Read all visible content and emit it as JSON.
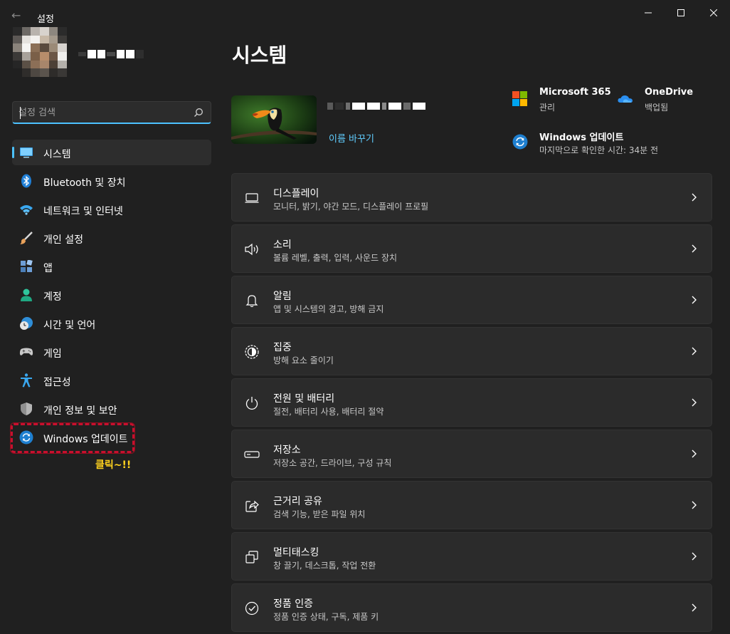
{
  "window": {
    "title": "설정",
    "back_glyph": "←"
  },
  "search": {
    "placeholder": "설정 검색"
  },
  "sidebar": {
    "items": [
      {
        "label": "시스템",
        "icon": "system-icon",
        "selected": true
      },
      {
        "label": "Bluetooth 및 장치",
        "icon": "bluetooth-icon"
      },
      {
        "label": "네트워크 및 인터넷",
        "icon": "wifi-icon"
      },
      {
        "label": "개인 설정",
        "icon": "brush-icon"
      },
      {
        "label": "앱",
        "icon": "apps-icon"
      },
      {
        "label": "계정",
        "icon": "account-icon"
      },
      {
        "label": "시간 및 언어",
        "icon": "time-language-icon"
      },
      {
        "label": "게임",
        "icon": "gamepad-icon"
      },
      {
        "label": "접근성",
        "icon": "accessibility-icon"
      },
      {
        "label": "개인 정보 및 보안",
        "icon": "shield-icon"
      },
      {
        "label": "Windows 업데이트",
        "icon": "windows-update-icon"
      }
    ],
    "annotation": "클릭~!!"
  },
  "main": {
    "title": "시스템",
    "rename_link": "이름 바꾸기",
    "quick_links": [
      {
        "title": "Microsoft 365",
        "subtitle": "관리",
        "icon": "microsoft-logo-icon"
      },
      {
        "title": "OneDrive",
        "subtitle": "백업됨",
        "icon": "onedrive-cloud-icon"
      },
      {
        "title": "Windows 업데이트",
        "subtitle": "마지막으로 확인한 시간: 34분 전",
        "icon": "windows-update-icon"
      }
    ],
    "cards": [
      {
        "title": "디스플레이",
        "subtitle": "모니터, 밝기, 야간 모드, 디스플레이 프로필",
        "icon": "display-icon"
      },
      {
        "title": "소리",
        "subtitle": "볼륨 레벨, 출력, 입력, 사운드 장치",
        "icon": "speaker-icon"
      },
      {
        "title": "알림",
        "subtitle": "앱 및 시스템의 경고, 방해 금지",
        "icon": "bell-icon"
      },
      {
        "title": "집중",
        "subtitle": "방해 요소 줄이기",
        "icon": "focus-icon"
      },
      {
        "title": "전원 및 배터리",
        "subtitle": "절전, 배터리 사용, 배터리 절약",
        "icon": "power-icon"
      },
      {
        "title": "저장소",
        "subtitle": "저장소 공간, 드라이브, 구성 규칙",
        "icon": "storage-icon"
      },
      {
        "title": "근거리 공유",
        "subtitle": "검색 기능, 받은 파일 위치",
        "icon": "share-icon"
      },
      {
        "title": "멀티태스킹",
        "subtitle": "창 끌기, 데스크톱, 작업 전환",
        "icon": "multitasking-icon"
      },
      {
        "title": "정품 인증",
        "subtitle": "정품 인증 상태, 구독, 제품 키",
        "icon": "activation-check-icon"
      }
    ]
  },
  "colors": {
    "background": "#202020",
    "card": "#2b2b2b",
    "accent": "#4cc2ff",
    "link": "#60cdff",
    "highlight_box": "#c8102e",
    "annotation": "#ffd21f"
  }
}
